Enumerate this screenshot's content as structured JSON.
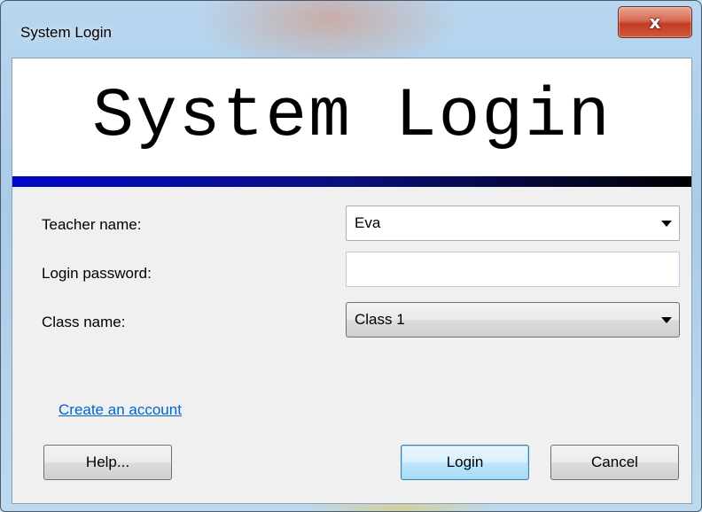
{
  "window": {
    "title": "System Login",
    "close_glyph": "x"
  },
  "banner": {
    "title": "System Login",
    "bar_colors": [
      "#0008c8",
      "#000000"
    ]
  },
  "form": {
    "teacher_label": "Teacher name:",
    "teacher_value": "Eva",
    "password_label": "Login password:",
    "password_value": "",
    "class_label": "Class name:",
    "class_value": "Class 1"
  },
  "links": {
    "create_account": "Create an account"
  },
  "buttons": {
    "help": "Help...",
    "login": "Login",
    "cancel": "Cancel"
  },
  "icons": {
    "close": "close-icon",
    "dropdown": "chevron-down-icon"
  },
  "colors": {
    "link": "#0066cc",
    "close_button": "#c23b22",
    "default_button": "#3c7fb1"
  }
}
